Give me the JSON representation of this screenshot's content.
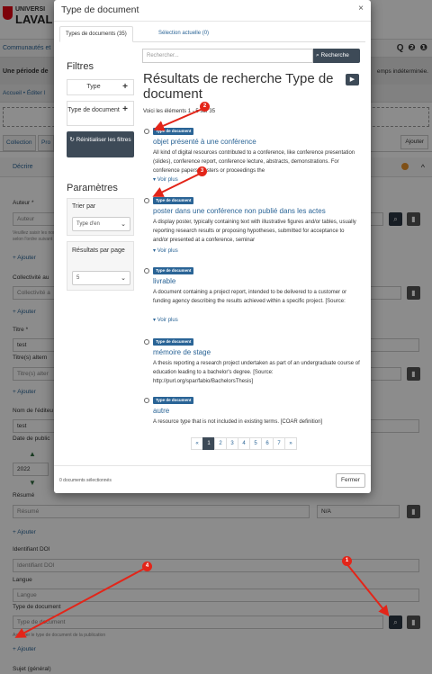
{
  "background": {
    "logo_top": "UNIVERSI",
    "logo_main": "LAVAL",
    "nav_text": "Communautés et",
    "nav_icons": "Q ❷ ❶",
    "banner_left": "Une période de",
    "banner_right": "emps indéterminée.",
    "breadcrumb": "Accueil • Éditer l",
    "tab_collection": "Collection",
    "tab_pro": "Pro",
    "tab_right": "Ajouter",
    "section_title": "Décrire",
    "author_label": "Auteur *",
    "author_placeholder": "Auteur",
    "author_help_1": "Veuillez saisir les noms de famille puis les prénoms",
    "author_help_2": "selon l'ordre suivant",
    "add_label": "+ Ajouter",
    "collectivity_label": "Collectivité au",
    "collectivity_placeholder": "Collectivité a",
    "title_label": "Titre *",
    "title_value": "test",
    "alt_title_label": "Titre(s) altern",
    "alt_title_placeholder": "Titre(s) alter",
    "editor_label": "Nom de l'éditeu",
    "editor_value": "test",
    "date_label": "Date de public",
    "year_value": "2022",
    "summary_label": "Résumé",
    "summary_placeholder": "Résumé",
    "summary_select": "N/A",
    "doi_label": "Identifiant DOI",
    "doi_placeholder": "Identifiant DOI",
    "language_label": "Langue",
    "language_placeholder": "Langue",
    "doctype_label": "Type de document",
    "doctype_placeholder": "Type de document",
    "doctype_help": "Associer le type de document de la publication",
    "subject_label": "Sujet (général)"
  },
  "modal": {
    "title": "Type de document",
    "close_icon": "×",
    "tabs": [
      {
        "label": "Types de documents (35)"
      },
      {
        "label": "Sélection actuelle (0)"
      }
    ],
    "filters_title": "Filtres",
    "filter_type": "Type",
    "filter_doctype": "Type de document",
    "reset_label": "Réinitialiser les filtres",
    "settings_title": "Paramètres",
    "sort_label": "Trier par",
    "sort_value": "Type d'en",
    "per_page_label": "Résultats par page",
    "per_page_value": "5",
    "search_placeholder": "Rechercher...",
    "search_button": "Recherche",
    "results_title": "Résultats de recherche Type de document",
    "results_count": "Voici les éléments 1 - 5 sur 35",
    "badge": "Type de document",
    "more_label": "Voir plus",
    "results": [
      {
        "title": "objet présenté à une conférence",
        "desc": "All kind of digital resources contributed to a conference, like conference presentation (slides), conference report, conference lecture, abstracts, demonstrations. For conference papers, posters or proceedings the",
        "more": "Voir plus"
      },
      {
        "title": "poster dans une conférence non publié dans les actes",
        "desc": "A display poster, typically containing text with illustrative figures and/or tables, usually reporting research results or proposing hypotheses, submitted for acceptance to and/or presented at a conference, seminar",
        "more": "Voir plus"
      },
      {
        "title": "livrable",
        "desc": "A document containing a project report, intended to be delivered to a customer or funding agency describing the results achieved within a specific project. [Source:",
        "more": "Voir plus"
      },
      {
        "title": "mémoire de stage",
        "desc": "A thesis reporting a research project undertaken as part of an undergraduate course of education leading to a bachelor's degree. [Source: http://purl.org/spar/fabio/BachelorsThesis]",
        "more": ""
      },
      {
        "title": "autre",
        "desc": "A resource type that is not included in existing terms. [COAR definition]",
        "more": ""
      }
    ],
    "pagination": [
      "«",
      "1",
      "2",
      "3",
      "4",
      "5",
      "6",
      "7",
      "»"
    ],
    "active_page": "1",
    "selected_count": "0 documents sélectionnés",
    "close_button": "Fermer"
  },
  "annotations": {
    "markers": [
      "1",
      "2",
      "3",
      "4"
    ],
    "color": "#e32519"
  }
}
